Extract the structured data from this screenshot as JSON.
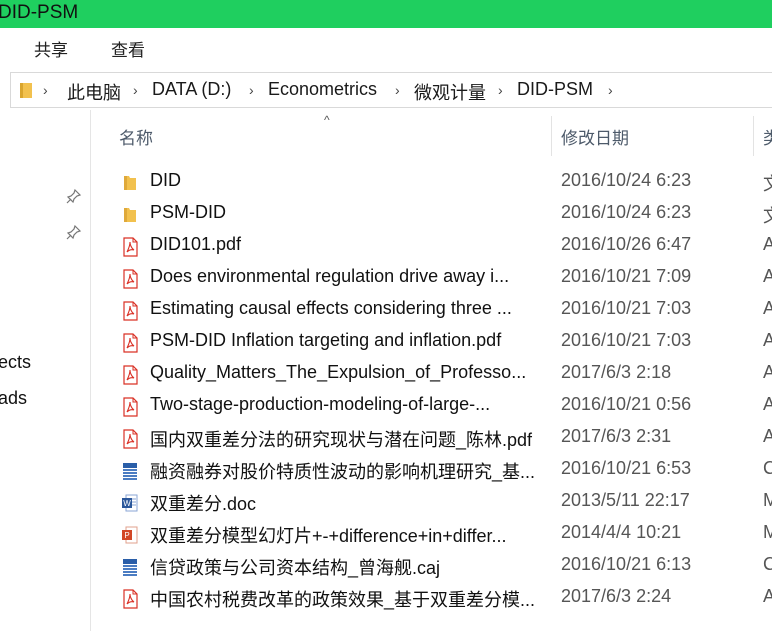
{
  "window": {
    "title": "DID-PSM"
  },
  "ribbon": {
    "tabs": [
      "共享",
      "查看"
    ]
  },
  "address": {
    "crumbs": [
      "此电脑",
      "DATA (D:)",
      "Econometrics",
      "微观计量",
      "DID-PSM"
    ]
  },
  "nav": {
    "partial_items": [
      "ects",
      "ads"
    ]
  },
  "header": {
    "name": "名称",
    "date": "修改日期",
    "type": "类"
  },
  "files": [
    {
      "name": "DID",
      "date": "2016/10/24 6:23",
      "type": "文",
      "icon": "folder-icon"
    },
    {
      "name": "PSM-DID",
      "date": "2016/10/24 6:23",
      "type": "文",
      "icon": "folder-icon"
    },
    {
      "name": "DID101.pdf",
      "date": "2016/10/26 6:47",
      "type": "A",
      "icon": "pdf-icon"
    },
    {
      "name": "Does environmental regulation drive away i...",
      "date": "2016/10/21 7:09",
      "type": "A",
      "icon": "pdf-icon"
    },
    {
      "name": "Estimating causal effects considering three ...",
      "date": "2016/10/21 7:03",
      "type": "A",
      "icon": "pdf-icon"
    },
    {
      "name": "PSM-DID Inflation targeting and inflation.pdf",
      "date": "2016/10/21 7:03",
      "type": "A",
      "icon": "pdf-icon"
    },
    {
      "name": "Quality_Matters_The_Expulsion_of_Professo...",
      "date": "2017/6/3 2:18",
      "type": "A",
      "icon": "pdf-icon"
    },
    {
      "name": "Two-stage-production-modeling-of-large-...",
      "date": "2016/10/21 0:56",
      "type": "A",
      "icon": "pdf-icon"
    },
    {
      "name": "国内双重差分法的研究现状与潜在问题_陈林.pdf",
      "date": "2017/6/3 2:31",
      "type": "A",
      "icon": "pdf-icon"
    },
    {
      "name": "融资融券对股价特质性波动的影响机理研究_基...",
      "date": "2016/10/21 6:53",
      "type": "C",
      "icon": "caj-icon"
    },
    {
      "name": "双重差分.doc",
      "date": "2013/5/11 22:17",
      "type": "M",
      "icon": "word-icon"
    },
    {
      "name": "双重差分模型幻灯片+-+difference+in+differ...",
      "date": "2014/4/4 10:21",
      "type": "M",
      "icon": "ppt-icon"
    },
    {
      "name": "信贷政策与公司资本结构_曾海舰.caj",
      "date": "2016/10/21 6:13",
      "type": "C",
      "icon": "caj-icon"
    },
    {
      "name": "中国农村税费改革的政策效果_基于双重差分模...",
      "date": "2017/6/3 2:24",
      "type": "A",
      "icon": "pdf-icon"
    }
  ],
  "colors": {
    "titlebar": "#1fcf5f",
    "folder": "#f2c14e",
    "pdf": "#d93025",
    "word": "#2b579a",
    "ppt": "#d24726",
    "caj": "#2a5ea8"
  }
}
